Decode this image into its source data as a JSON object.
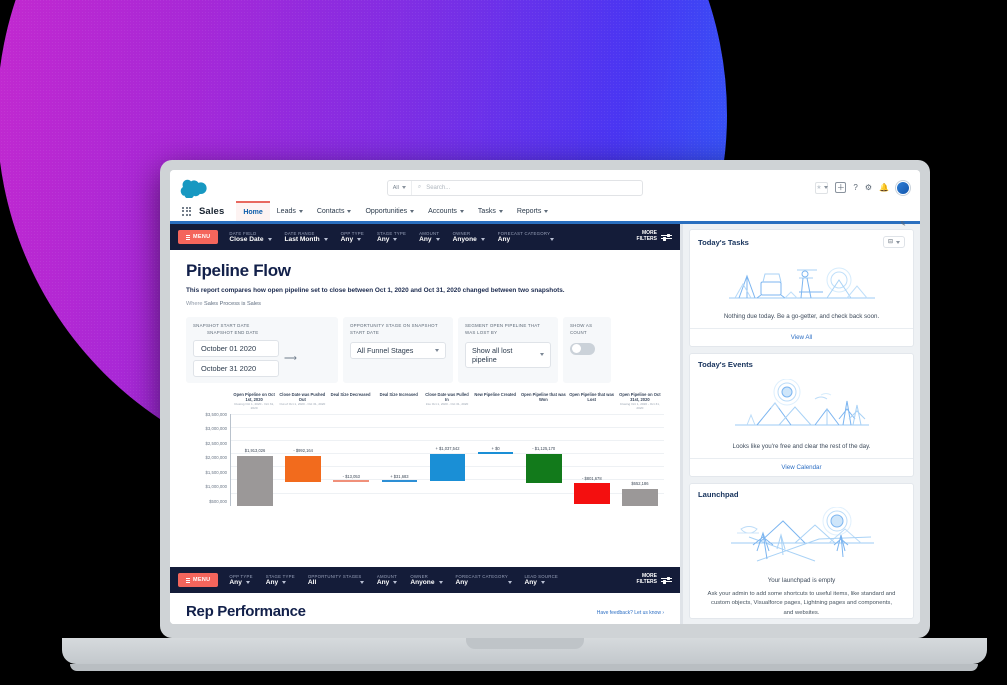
{
  "header": {
    "logo_icon": "salesforce-cloud-icon",
    "search": {
      "scope": "All",
      "placeholder": "Search...",
      "icon": "search-icon"
    },
    "icons": [
      "favorites-icon",
      "favorites-dropdown-icon",
      "add-icon",
      "help-icon",
      "setup-gear-icon",
      "notifications-bell-icon",
      "user-avatar"
    ],
    "app_name": "Sales",
    "waffle_icon": "app-launcher-icon",
    "edit_icon": "pencil-edit-icon",
    "nav": [
      {
        "label": "Home",
        "has_caret": false,
        "active": true
      },
      {
        "label": "Leads",
        "has_caret": true,
        "active": false
      },
      {
        "label": "Contacts",
        "has_caret": true,
        "active": false
      },
      {
        "label": "Opportunities",
        "has_caret": true,
        "active": false
      },
      {
        "label": "Accounts",
        "has_caret": true,
        "active": false
      },
      {
        "label": "Tasks",
        "has_caret": true,
        "active": false
      },
      {
        "label": "Reports",
        "has_caret": true,
        "active": false
      }
    ]
  },
  "top_filter_bar": {
    "menu_label": "MENU",
    "more_filters_line1": "MORE",
    "more_filters_line2": "FILTERS",
    "filters": [
      {
        "label": "DATE FIELD",
        "value": "Close Date"
      },
      {
        "label": "DATE RANGE",
        "value": "Last Month"
      },
      {
        "label": "OPP TYPE",
        "value": "Any"
      },
      {
        "label": "STAGE TYPE",
        "value": "Any"
      },
      {
        "label": "AMOUNT",
        "value": "Any"
      },
      {
        "label": "OWNER",
        "value": "Anyone"
      },
      {
        "label": "FORECAST CATEGORY",
        "value": "Any"
      }
    ]
  },
  "report": {
    "title": "Pipeline Flow",
    "description": "This report compares how open pipeline set to close between Oct 1, 2020 and Oct 31, 2020 changed between two snapshots.",
    "where_prefix": "Where",
    "where_value": "Sales Process is Sales",
    "controls": {
      "snapshot_start_label": "SNAPSHOT START DATE",
      "snapshot_end_label": "SNAPSHOT END DATE",
      "start_date": "October 01 2020",
      "end_date": "October 31 2020",
      "arrow_icon": "arrow-right-icon",
      "stage_label_line1": "OPPORTUNITY STAGE ON SNAPSHOT",
      "stage_label_line2": "START DATE",
      "stage_value": "All Funnel Stages",
      "segment_label_line1": "SEGMENT OPEN PIPELINE THAT",
      "segment_label_line2": "WAS LOST BY",
      "segment_value": "Show all lost pipeline",
      "show_as_label_line1": "SHOW AS",
      "show_as_label_line2": "COUNT",
      "show_as_on": false
    }
  },
  "chart_data": {
    "type": "bar",
    "title": "Pipeline Flow",
    "xlabel": "",
    "ylabel": "",
    "ylim": [
      0,
      3500000
    ],
    "grid": true,
    "legend": "none",
    "ytick_labels": [
      "$3,500,000",
      "$3,000,000",
      "$2,500,000",
      "$2,000,000",
      "$1,500,000",
      "$1,000,000",
      "$500,000"
    ],
    "ytick_values": [
      3500000,
      3000000,
      2500000,
      2000000,
      1500000,
      1000000,
      500000
    ],
    "categories": [
      "Open Pipeline on Oct 1st, 2020",
      "Close Date was Pushed Out",
      "Deal Size Decreased",
      "Deal Size Increased",
      "Close Date was Pulled In",
      "New Pipeline Created",
      "Open Pipeline that was Won",
      "Open Pipeline that was Lost",
      "Open Pipeline on Oct 31st, 2020"
    ],
    "category_sublabels": [
      "Closing Oct 1, 2020 - Oct 31, 2020",
      "Out of Oct 1, 2020 - Oct 31, 2020",
      "",
      "",
      "Into Oct 1, 2020 - Oct 31, 2020",
      "",
      "",
      "",
      "Closing Oct 1, 2020 - Oct 31, 2020"
    ],
    "labels": [
      "$1,913,026",
      "- $992,164",
      "- $13,053",
      "+ $31,683",
      "+ $1,037,542",
      "+ $0",
      "- $1,125,170",
      "- $801,678",
      "$652,186"
    ],
    "values": [
      1913026,
      -992164,
      -13053,
      31683,
      1037542,
      0,
      -1125170,
      -801678,
      652186
    ],
    "bar_colors": [
      "#9b9898",
      "#f26b1d",
      "#f0907a",
      "#2d8fd5",
      "#1a8fd6",
      "#1a8fd6",
      "#127a1b",
      "#f40f0f",
      "#9b9898"
    ],
    "bar_kinds": [
      "total",
      "delta",
      "delta",
      "delta",
      "delta",
      "zero",
      "delta",
      "delta",
      "total"
    ]
  },
  "bottom_filter_bar": {
    "menu_label": "MENU",
    "more_filters_line1": "MORE",
    "more_filters_line2": "FILTERS",
    "filters": [
      {
        "label": "OPP TYPE",
        "value": "Any"
      },
      {
        "label": "STAGE TYPE",
        "value": "Any"
      },
      {
        "label": "OPPORTUNITY STAGES",
        "value": "All"
      },
      {
        "label": "AMOUNT",
        "value": "Any"
      },
      {
        "label": "OWNER",
        "value": "Anyone"
      },
      {
        "label": "FORECAST CATEGORY",
        "value": "Any"
      },
      {
        "label": "LEAD SOURCE",
        "value": "Any"
      }
    ]
  },
  "rep_performance": {
    "title": "Rep Performance",
    "feedback": "Have feedback? Let us know ›"
  },
  "sidebar": {
    "tasks": {
      "title": "Today's Tasks",
      "menu_icon": "list-options-icon",
      "caret_icon": "chevron-down-icon",
      "illustration": "empty-tasks-illustration",
      "message": "Nothing due today. Be a go-getter, and check back soon.",
      "footer_link": "View All"
    },
    "events": {
      "title": "Today's Events",
      "illustration": "empty-events-illustration",
      "message": "Looks like you're free and clear the rest of the day.",
      "footer_link": "View Calendar"
    },
    "launchpad": {
      "title": "Launchpad",
      "illustration": "empty-launchpad-illustration",
      "message": "Your launchpad is empty",
      "submessage": "Ask your admin to add some shortcuts to useful items, like standard and custom objects, Visualforce pages, Lightning pages and components, and websites."
    }
  }
}
